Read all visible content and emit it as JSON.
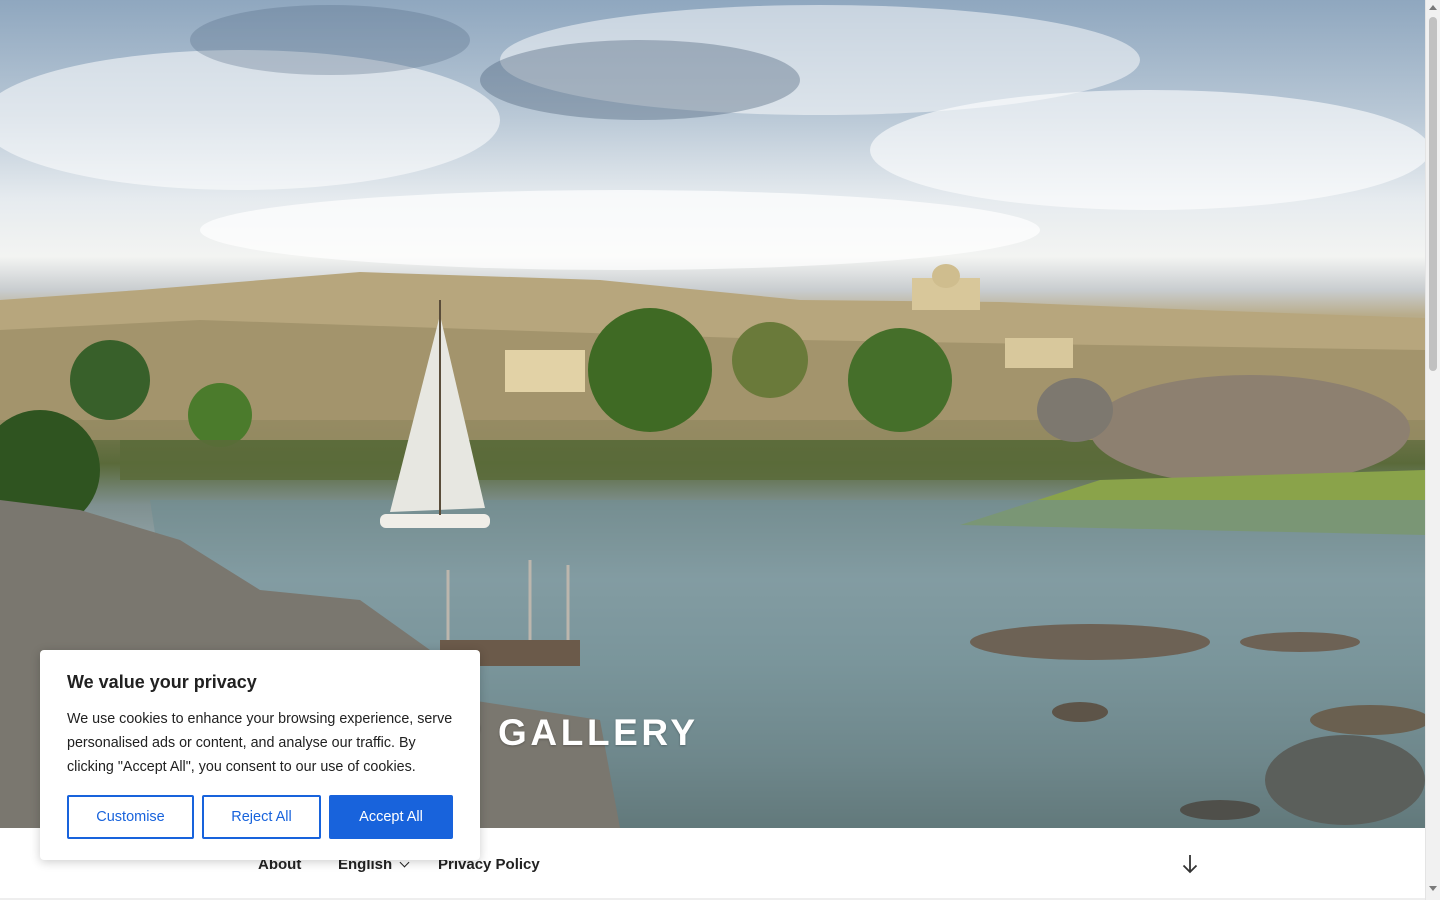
{
  "site": {
    "title": "EGYPTIAN MAP GALLERY",
    "hero_alt": "Felucca sailing on the Nile near Aswan"
  },
  "nav": {
    "items": [
      {
        "label": "About"
      },
      {
        "label": "English",
        "has_submenu": true
      },
      {
        "label": "Privacy Policy"
      }
    ],
    "scroll_icon": "arrow-down-icon"
  },
  "cookie_banner": {
    "title": "We value your privacy",
    "text": "We use cookies to enhance your browsing experience, serve personalised ads or content, and analyse our traffic. By clicking \"Accept All\", you consent to our use of cookies.",
    "buttons": {
      "customise": "Customise",
      "reject": "Reject All",
      "accept": "Accept All"
    },
    "colors": {
      "accent": "#1863dc"
    }
  },
  "scrollbar": {
    "scroll_position": 0
  }
}
